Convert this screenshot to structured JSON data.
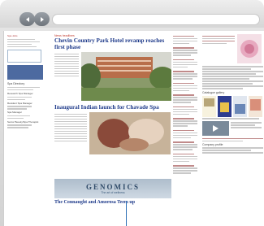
{
  "sidebar": {
    "links": [
      "Spa Jobs"
    ],
    "spa_directory": "Spa Directory",
    "jobs": [
      {
        "title": "Research Spa Manager"
      },
      {
        "title": "Resident Spa Manager"
      },
      {
        "title": "Spa Manager"
      },
      {
        "title": "Senior Beauty/Spa Therapist"
      }
    ]
  },
  "main": {
    "section_label": "News headlines",
    "stories": [
      {
        "headline": "Chevin Country Park Hotel revamp reaches first phase"
      },
      {
        "headline": "Inaugural Indian launch for Chavade Spa"
      },
      {
        "headline": "The Connaught and Amorosa Teem up"
      }
    ],
    "ad": {
      "title": "GENOMICS",
      "subtitle": "The art of wellness"
    }
  },
  "right": {
    "catalogue_label": "Catalogue gallery",
    "company_profile": "Company profile"
  },
  "colors": {
    "headline": "#1e3a8a",
    "section": "#c0392b",
    "accent_ad": "#4d6aa0",
    "cursor": "#2b6fb5"
  }
}
